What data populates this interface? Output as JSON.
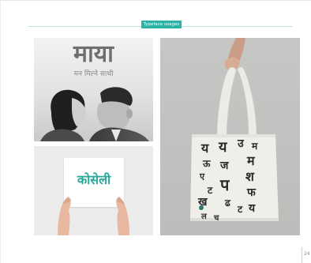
{
  "header": {
    "tag_label": "Typeface usages",
    "accent_color": "#2bb3a5"
  },
  "poster": {
    "title": "माया",
    "subtitle": "मन मिल्ने साथी"
  },
  "book": {
    "title": "कोसेली",
    "title_color": "#27a99a"
  },
  "tote": {
    "glyphs": [
      {
        "text": "य"
      },
      {
        "text": "य"
      },
      {
        "text": "उ"
      },
      {
        "text": "म"
      },
      {
        "text": "म"
      },
      {
        "text": "ऊ"
      },
      {
        "text": "ज"
      },
      {
        "text": "श"
      },
      {
        "text": "ए"
      },
      {
        "text": "प"
      },
      {
        "text": "ट"
      },
      {
        "text": "फ"
      },
      {
        "text": "ख"
      },
      {
        "text": "ढ"
      },
      {
        "text": "ट"
      },
      {
        "text": "य"
      },
      {
        "text": "ल"
      },
      {
        "text": "च"
      }
    ]
  },
  "footer": {
    "page_number": "24"
  }
}
